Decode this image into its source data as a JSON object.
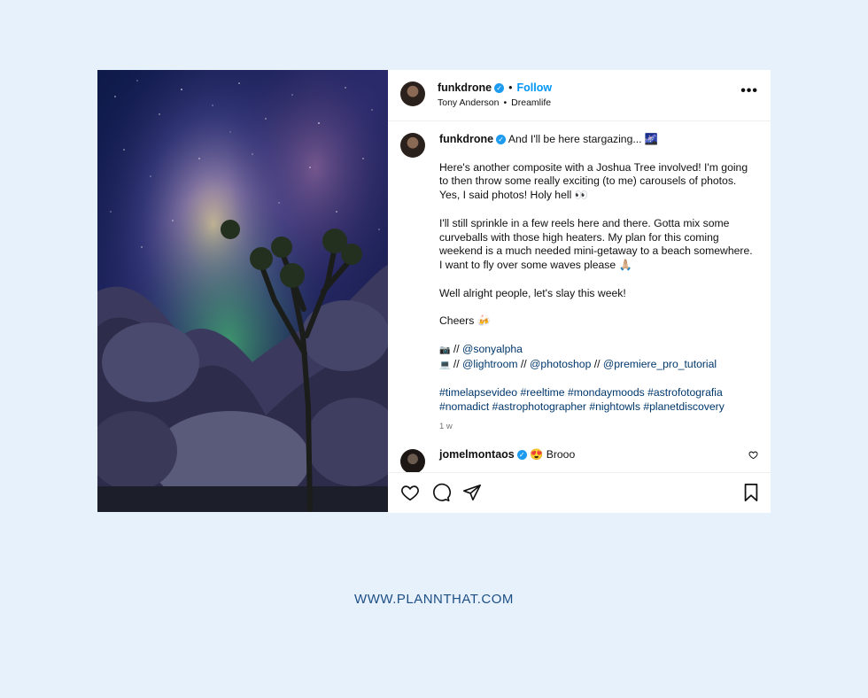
{
  "post": {
    "author": {
      "username": "funkdrone",
      "follow_label": "Follow",
      "subtitle_name": "Tony Anderson",
      "subtitle_place": "Dreamlife"
    },
    "more_label": "•••",
    "caption": {
      "username": "funkdrone",
      "first_line": "And I'll be here stargazing... 🌌",
      "paragraph1": "Here's another composite with a Joshua Tree involved! I'm going to then throw some really exciting (to me) carousels of photos. Yes, I said photos! Holy hell 👀",
      "paragraph2": "I'll still sprinkle in a few reels here and there. Gotta mix some curveballs with those high heaters. My plan for this coming weekend is a much needed mini-getaway to a beach somewhere. I want to fly over some waves please 🙏🏼",
      "paragraph3": "Well alright people, let's slay this week!",
      "paragraph4": "Cheers 🍻",
      "credits": [
        {
          "icon": "📷",
          "sep": " // ",
          "mentions": [
            "@sonyalpha"
          ]
        },
        {
          "icon": "💻",
          "sep": " // ",
          "mentions": [
            "@lightroom",
            "@photoshop",
            "@premiere_pro_tutorial"
          ]
        }
      ],
      "hashtags_line1": "#timelapsevideo #reeltime #mondaymoods #astrofotografia",
      "hashtags_line2": "#nomadict #astrophotographer #nightowls #planetdiscovery",
      "time": "1 w"
    },
    "comment": {
      "username": "jomelmontaos",
      "text": "😍 Brooo"
    }
  },
  "footer": {
    "url": "WWW.PLANNTHAT.COM"
  },
  "colors": {
    "background": "#e7f1fc",
    "follow": "#0095f6",
    "link": "#00376b",
    "footer": "#1e4f84"
  },
  "icons": [
    "verified-badge-icon",
    "more-options-icon",
    "heart-icon",
    "comment-icon",
    "share-icon",
    "bookmark-icon"
  ]
}
